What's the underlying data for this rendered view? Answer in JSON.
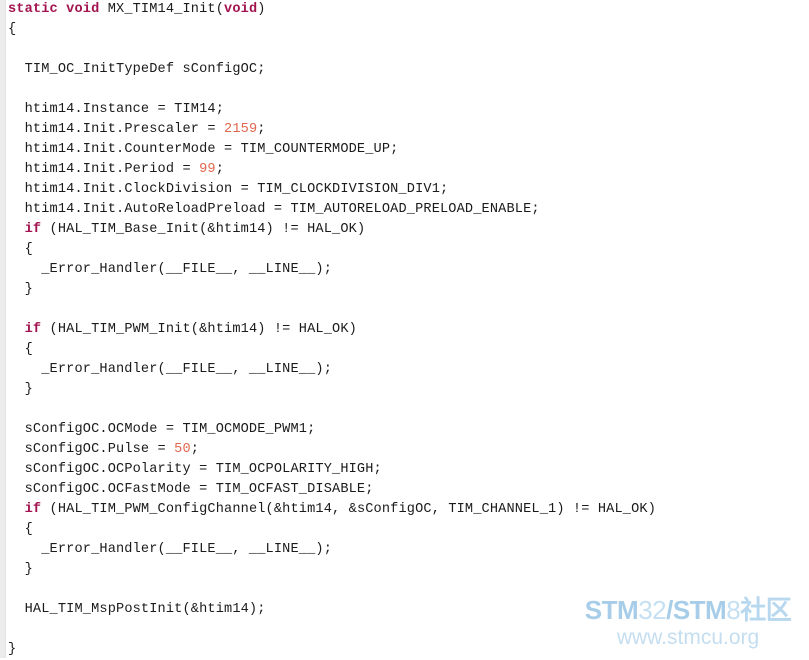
{
  "viewer": {
    "background_color": "#ffffff",
    "gutter_color": "#ececed",
    "text_color": "#1b1b1b",
    "keyword_color": "#a2134f",
    "number_color": "#e0664f",
    "language": "C",
    "function_name": "MX_TIM14_Init"
  },
  "code": {
    "lines": [
      {
        "n": 1,
        "indent": 0,
        "tokens": [
          {
            "t": "kw",
            "v": "static void"
          },
          {
            "t": "pl",
            "v": " MX_TIM14_Init("
          },
          {
            "t": "kw",
            "v": "void"
          },
          {
            "t": "pl",
            "v": ")"
          }
        ]
      },
      {
        "n": 2,
        "indent": 0,
        "tokens": [
          {
            "t": "pl",
            "v": "{"
          }
        ]
      },
      {
        "n": 3,
        "indent": 0,
        "tokens": []
      },
      {
        "n": 4,
        "indent": 2,
        "tokens": [
          {
            "t": "pl",
            "v": "TIM_OC_InitTypeDef sConfigOC;"
          }
        ]
      },
      {
        "n": 5,
        "indent": 0,
        "tokens": []
      },
      {
        "n": 6,
        "indent": 2,
        "tokens": [
          {
            "t": "pl",
            "v": "htim14.Instance = TIM14;"
          }
        ]
      },
      {
        "n": 7,
        "indent": 2,
        "tokens": [
          {
            "t": "pl",
            "v": "htim14.Init.Prescaler = "
          },
          {
            "t": "num",
            "v": "2159"
          },
          {
            "t": "pl",
            "v": ";"
          }
        ]
      },
      {
        "n": 8,
        "indent": 2,
        "tokens": [
          {
            "t": "pl",
            "v": "htim14.Init.CounterMode = TIM_COUNTERMODE_UP;"
          }
        ]
      },
      {
        "n": 9,
        "indent": 2,
        "tokens": [
          {
            "t": "pl",
            "v": "htim14.Init.Period = "
          },
          {
            "t": "num",
            "v": "99"
          },
          {
            "t": "pl",
            "v": ";"
          }
        ]
      },
      {
        "n": 10,
        "indent": 2,
        "tokens": [
          {
            "t": "pl",
            "v": "htim14.Init.ClockDivision = TIM_CLOCKDIVISION_DIV1;"
          }
        ]
      },
      {
        "n": 11,
        "indent": 2,
        "tokens": [
          {
            "t": "pl",
            "v": "htim14.Init.AutoReloadPreload = TIM_AUTORELOAD_PRELOAD_ENABLE;"
          }
        ]
      },
      {
        "n": 12,
        "indent": 2,
        "tokens": [
          {
            "t": "kw",
            "v": "if"
          },
          {
            "t": "pl",
            "v": " (HAL_TIM_Base_Init(&htim14) != HAL_OK)"
          }
        ]
      },
      {
        "n": 13,
        "indent": 2,
        "tokens": [
          {
            "t": "pl",
            "v": "{"
          }
        ]
      },
      {
        "n": 14,
        "indent": 4,
        "tokens": [
          {
            "t": "pl",
            "v": "_Error_Handler(__FILE__, __LINE__);"
          }
        ]
      },
      {
        "n": 15,
        "indent": 2,
        "tokens": [
          {
            "t": "pl",
            "v": "}"
          }
        ]
      },
      {
        "n": 16,
        "indent": 0,
        "tokens": []
      },
      {
        "n": 17,
        "indent": 2,
        "tokens": [
          {
            "t": "kw",
            "v": "if"
          },
          {
            "t": "pl",
            "v": " (HAL_TIM_PWM_Init(&htim14) != HAL_OK)"
          }
        ]
      },
      {
        "n": 18,
        "indent": 2,
        "tokens": [
          {
            "t": "pl",
            "v": "{"
          }
        ]
      },
      {
        "n": 19,
        "indent": 4,
        "tokens": [
          {
            "t": "pl",
            "v": "_Error_Handler(__FILE__, __LINE__);"
          }
        ]
      },
      {
        "n": 20,
        "indent": 2,
        "tokens": [
          {
            "t": "pl",
            "v": "}"
          }
        ]
      },
      {
        "n": 21,
        "indent": 0,
        "tokens": []
      },
      {
        "n": 22,
        "indent": 2,
        "tokens": [
          {
            "t": "pl",
            "v": "sConfigOC.OCMode = TIM_OCMODE_PWM1;"
          }
        ]
      },
      {
        "n": 23,
        "indent": 2,
        "tokens": [
          {
            "t": "pl",
            "v": "sConfigOC.Pulse = "
          },
          {
            "t": "num",
            "v": "50"
          },
          {
            "t": "pl",
            "v": ";"
          }
        ]
      },
      {
        "n": 24,
        "indent": 2,
        "tokens": [
          {
            "t": "pl",
            "v": "sConfigOC.OCPolarity = TIM_OCPOLARITY_HIGH;"
          }
        ]
      },
      {
        "n": 25,
        "indent": 2,
        "tokens": [
          {
            "t": "pl",
            "v": "sConfigOC.OCFastMode = TIM_OCFAST_DISABLE;"
          }
        ]
      },
      {
        "n": 26,
        "indent": 2,
        "tokens": [
          {
            "t": "kw",
            "v": "if"
          },
          {
            "t": "pl",
            "v": " (HAL_TIM_PWM_ConfigChannel(&htim14, &sConfigOC, TIM_CHANNEL_1) != HAL_OK)"
          }
        ]
      },
      {
        "n": 27,
        "indent": 2,
        "tokens": [
          {
            "t": "pl",
            "v": "{"
          }
        ]
      },
      {
        "n": 28,
        "indent": 4,
        "tokens": [
          {
            "t": "pl",
            "v": "_Error_Handler(__FILE__, __LINE__);"
          }
        ]
      },
      {
        "n": 29,
        "indent": 2,
        "tokens": [
          {
            "t": "pl",
            "v": "}"
          }
        ]
      },
      {
        "n": 30,
        "indent": 0,
        "tokens": []
      },
      {
        "n": 31,
        "indent": 2,
        "tokens": [
          {
            "t": "pl",
            "v": "HAL_TIM_MspPostInit(&htim14);"
          }
        ]
      },
      {
        "n": 32,
        "indent": 0,
        "tokens": []
      },
      {
        "n": 33,
        "indent": 0,
        "tokens": [
          {
            "t": "pl",
            "v": "}"
          }
        ]
      }
    ]
  },
  "watermark": {
    "brand_parts": [
      {
        "style": "strong",
        "text": "STM"
      },
      {
        "style": "light",
        "text": "32"
      },
      {
        "style": "strong",
        "text": "/STM"
      },
      {
        "style": "light",
        "text": "8"
      },
      {
        "style": "cjk",
        "text": "社区"
      }
    ],
    "brand_plain": "STM32/STM8社区",
    "url": "www.stmcu.org",
    "strong_color": "#a7cde8",
    "light_color": "#c5e0f2",
    "url_color": "#c4def0"
  }
}
